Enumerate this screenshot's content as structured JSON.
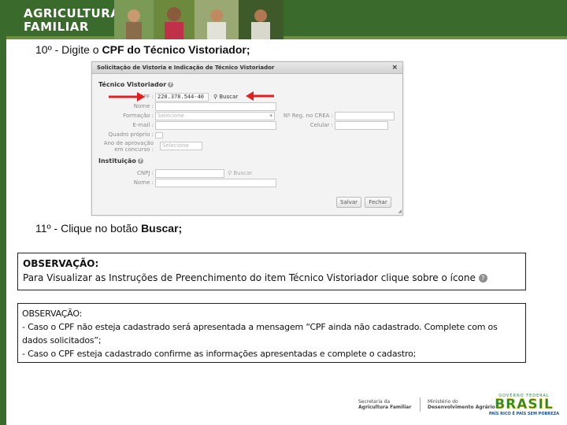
{
  "header": {
    "brand_line1": "AGRICULTURA",
    "brand_line2": "FAMILIAR"
  },
  "steps": {
    "step10_prefix": "10º - Digite o ",
    "step10_bold": "CPF do Técnico Vistoriador;",
    "step11_prefix": "11º - Clique no botão ",
    "step11_bold": "Buscar;"
  },
  "dialog": {
    "title": "Solicitação de Vistoria e Indicação de Técnico Vistoriador",
    "close": "×",
    "section_tecnico": "Técnico Vistoriador",
    "cpf_label": "CPF :",
    "cpf_value": "220.378.544-40",
    "buscar": "Buscar",
    "nome_label": "Nome :",
    "formacao_label": "Formação :",
    "formacao_value": "Selecione",
    "reg_label": "Nº Reg. no CREA :",
    "email_label": "E-mail :",
    "celular_label": "Celular :",
    "quadro_label": "Quadro próprio :",
    "ano_label_1": "Ano de aprovação",
    "ano_label_2": "em concurso :",
    "ano_value": "Selecione",
    "section_instituicao": "Instituição",
    "cnpj_label": "CNPJ :",
    "buscar2": "Buscar",
    "nome2_label": "Nome :",
    "salvar": "Salvar",
    "fechar": "Fechar"
  },
  "observacao1": {
    "title": "OBSERVAÇÃO:",
    "text": "Para Visualizar as Instruções de Preenchimento do item Técnico Vistoriador clique sobre o ícone"
  },
  "observacao2": {
    "title": "OBSERVAÇÃO:",
    "line1": "- Caso o CPF não esteja cadastrado será apresentada a mensagem “CPF ainda não cadastrado. Complete com os dados solicitados”;",
    "line2": "- Caso o CPF esteja cadastrado confirme as informações apresentadas e complete o cadastro;"
  },
  "footer": {
    "logo1_line1": "Secretaria da",
    "logo1_line2": "Agricultura Familiar",
    "logo2_line1": "Ministério do",
    "logo2_line2": "Desenvolvimento Agrário",
    "brasil_top": "GOVERNO FEDERAL",
    "brasil_word": "BRASIL",
    "brasil_sub": "PAÍS RICO É PAÍS SEM POBREZA"
  },
  "colors": {
    "header_green": "#3a6a2c",
    "arrow_red": "#e02020",
    "brasil_green": "#1f8a3a",
    "brasil_yellow": "#f2c200",
    "brasil_blue": "#1d4f9c"
  }
}
